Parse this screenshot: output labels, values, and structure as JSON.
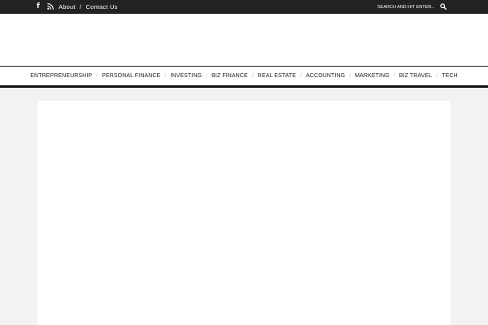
{
  "topbar": {
    "social": {
      "facebook_icon": "facebook-icon",
      "facebook_glyph": "f",
      "rss_icon": "rss-icon"
    },
    "links": [
      {
        "label": "About"
      },
      {
        "label": "Contact Us"
      }
    ],
    "link_separator": "/",
    "search": {
      "placeholder": "Search and hit enter...",
      "icon": "search-icon"
    }
  },
  "nav": {
    "items": [
      {
        "label": "ENTREPRENEURSHIP"
      },
      {
        "label": "PERSONAL FINANCE"
      },
      {
        "label": "INVESTING"
      },
      {
        "label": "BIZ FINANCE"
      },
      {
        "label": "REAL ESTATE"
      },
      {
        "label": "ACCOUNTING"
      },
      {
        "label": "MARKETING"
      },
      {
        "label": "BIZ TRAVEL"
      },
      {
        "label": "TECH"
      }
    ],
    "separator": "/"
  },
  "colors": {
    "topbar_bg": "#222222",
    "page_bg": "#f2f2f2",
    "content_bg": "#ffffff",
    "nav_border": "#111111"
  }
}
